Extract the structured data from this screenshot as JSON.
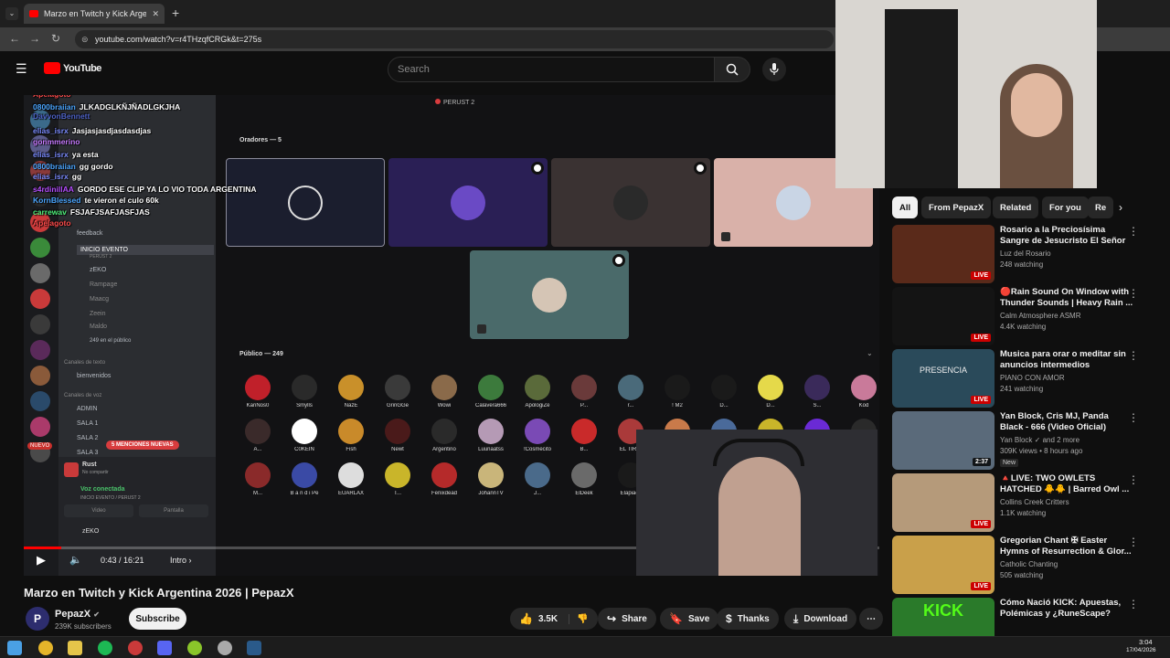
{
  "browser": {
    "tab_title": "Marzo en Twitch y Kick Argentina",
    "url": "youtube.com/watch?v=r4THzqfCRGk&t=275s"
  },
  "youtube": {
    "logo": "YouTube",
    "search_placeholder": "Search"
  },
  "overlay_chat": [
    {
      "user": "iilkhalifa7",
      "msg": "",
      "color": "#7b8cff"
    },
    {
      "user": "s4rdinillAA",
      "msg": "JAKJAJAKJAJKAJKJKAJAKAJKAJKA",
      "color": "#b64fff"
    },
    {
      "user": "elias_isrx",
      "msg": "",
      "color": "#7b8cff"
    },
    {
      "user": "Apelagoto",
      "msg": "",
      "color": "#ff4c4c"
    },
    {
      "user": "0800braiian",
      "msg": "JLKADGLKÑJÑADLGKJHA",
      "color": "#4ca6ff"
    },
    {
      "user": "DavvonBennett",
      "msg": "",
      "color": "#4f63c8"
    },
    {
      "user": "elias_isrx",
      "msg": "Jasjasjasdjasdasdjas",
      "color": "#7b8cff"
    },
    {
      "user": "gonmmerino",
      "msg": "",
      "color": "#c77bff"
    },
    {
      "user": "elias_isrx",
      "msg": "ya esta",
      "color": "#7b8cff"
    },
    {
      "user": "0800braiian",
      "msg": "gg gordo",
      "color": "#4ca6ff"
    },
    {
      "user": "elias_isrx",
      "msg": "gg",
      "color": "#7b8cff"
    },
    {
      "user": "s4rdinillAA",
      "msg": "GORDO ESE CLIP YA LO VIO TODA ARGENTINA",
      "color": "#b64fff"
    },
    {
      "user": "KornBlessed",
      "msg": "te vieron el culo 60k",
      "color": "#4ca6ff"
    },
    {
      "user": "carrewav",
      "msg": "FSJAFJSAFJASFJAS",
      "color": "#4ff07b"
    },
    {
      "user": "Apelagoto",
      "msg": "",
      "color": "#ff4c4c"
    }
  ],
  "discord": {
    "title": "PERUST 2",
    "speakers_label": "Oradores — 5",
    "audience_label": "Público — 249",
    "channels": [
      "feedback",
      "INICIO EVENTO",
      "PERUST 2",
      "zEKO",
      "Rampage",
      "zEKO",
      "Maacg",
      "Zeein",
      "Maldo",
      "249 en el público",
      "Canales de texto",
      "bienvenidos",
      "Canales de voz",
      "ADMIN",
      "SALA 1",
      "SALA 2",
      "SALA 3"
    ],
    "mentions_badge": "5 MENCIONES NUEVAS",
    "nuevo": "NUEVO",
    "new_badge": "NUEVO",
    "user_panel": {
      "name": "Rust",
      "sub": "No compartir",
      "voice": "Voz conectada",
      "voice_sub": "INICIO EVENTO / PERUST 2",
      "user": "zEKO"
    },
    "video_btn": "Video",
    "screen_btn": "Pantalla",
    "audience": [
      {
        "name": "KariÑos0",
        "color": "#c0202a"
      },
      {
        "name": "Smylls",
        "color": "#2a2a2a"
      },
      {
        "name": "NazE",
        "color": "#c9902a"
      },
      {
        "name": "GrinGGe",
        "color": "#3a3a3a"
      },
      {
        "name": "Wowi",
        "color": "#8a6a4a"
      },
      {
        "name": "Calavera666",
        "color": "#3c7a3c"
      },
      {
        "name": "ApologiZe",
        "color": "#5a6a3a"
      },
      {
        "name": "P...",
        "color": "#6a3a3a"
      },
      {
        "name": "r...",
        "color": "#4a6a7a"
      },
      {
        "name": "! M2",
        "color": "#1a1a1a"
      },
      {
        "name": "D...",
        "color": "#1a1a1a"
      },
      {
        "name": "D...",
        "color": "#e5d94a"
      },
      {
        "name": "S...",
        "color": "#3a2a5a"
      },
      {
        "name": "Kod",
        "color": "#c97a9a"
      },
      {
        "name": "A...",
        "color": "#3a2a2a"
      },
      {
        "name": "C0KEIN",
        "color": "#ffffff"
      },
      {
        "name": "Fish",
        "color": "#c98a2a"
      },
      {
        "name": "Newt",
        "color": "#4a1a1a"
      },
      {
        "name": "Argentino",
        "color": "#2a2a2a"
      },
      {
        "name": "Luunaatss",
        "color": "#b59ab5"
      },
      {
        "name": "!Cosmecito",
        "color": "#7a4ab5"
      },
      {
        "name": "B...",
        "color": "#c92a2a"
      },
      {
        "name": "EL TIRRI",
        "color": "#aa3a3a"
      },
      {
        "name": "Ay_Zarite",
        "color": "#c97a4a"
      },
      {
        "name": "L...",
        "color": "#4a6a9a"
      },
      {
        "name": "PUDÍN",
        "color": "#c9b52a"
      },
      {
        "name": "GaitoMC",
        "color": "#6a2ad5"
      },
      {
        "name": "S...",
        "color": "#2a2a2a"
      },
      {
        "name": "M...",
        "color": "#8a2a2a"
      },
      {
        "name": "B a n d i Pe",
        "color": "#3a4aa5"
      },
      {
        "name": "EUARLAX",
        "color": "#dddddd"
      },
      {
        "name": "T...",
        "color": "#c9b52a"
      },
      {
        "name": "Fenixdead",
        "color": "#b52a2a"
      },
      {
        "name": "JohannTV",
        "color": "#c9b57a"
      },
      {
        "name": "J...",
        "color": "#4a6a8a"
      },
      {
        "name": "ElDeek",
        "color": "#6a6a6a"
      },
      {
        "name": "Elapiack",
        "color": "#1a1a1a"
      },
      {
        "name": "Bikito",
        "color": "#3a2a3a"
      },
      {
        "name": "Bauty",
        "color": "#8a2a2a"
      },
      {
        "name": "N...",
        "color": "#c97a7a"
      },
      {
        "name": "Sonic4D",
        "color": "#3a5aa5"
      }
    ]
  },
  "controls": {
    "time": "0:43 / 16:21",
    "chapter": "Intro",
    "progress_fraction": 0.044
  },
  "video": {
    "title": "Marzo en Twitch y Kick Argentina 2026 | PepazX",
    "channel": "PepazX",
    "subscribers": "239K subscribers",
    "subscribe": "Subscribe",
    "likes": "3.5K",
    "share": "Share",
    "save": "Save",
    "thanks": "Thanks",
    "download": "Download"
  },
  "chips": [
    "All",
    "From PepazX",
    "Related",
    "For you",
    "Re"
  ],
  "related": [
    {
      "title": "Rosario a la Preciosísima Sangre de Jesucristo El Señor ...",
      "channel": "Luz del Rosario",
      "views": "248 watching",
      "badge": "LIVE",
      "thumb": "#5a2a1a"
    },
    {
      "title": "🔴Rain Sound On Window with Thunder Sounds | Heavy Rain ...",
      "channel": "Calm Atmosphere ASMR",
      "views": "4.4K watching",
      "badge": "LIVE",
      "thumb": "#141414"
    },
    {
      "title": "Musica para orar o meditar sin anuncios intermedios",
      "channel": "PIANO CON AMOR",
      "views": "241 watching",
      "badge": "LIVE",
      "thumb": "#2a4a5a",
      "thumb_text": "PRESENCIA"
    },
    {
      "title": "Yan Block, Cris MJ, Panda Black - 666 (Video Oficial)",
      "channel": "Yan Block ✓ and 2 more",
      "views": "309K views • 8 hours ago",
      "badge": "2:37",
      "new": "New",
      "thumb": "#5a6a7a"
    },
    {
      "title": "🔺LIVE: TWO OWLETS HATCHED 🐥🐥 | Barred Owl ...",
      "channel": "Collins Creek Critters",
      "views": "1.1K watching",
      "badge": "LIVE",
      "thumb": "#b59a7a"
    },
    {
      "title": "Gregorian Chant ✠ Easter Hymns of Resurrection & Glor...",
      "channel": "Catholic Chanting",
      "views": "505 watching",
      "badge": "LIVE",
      "thumb": "#c9a04a"
    },
    {
      "title": "Cómo Nació KICK: Apuestas, Polémicas y ¿RuneScape?",
      "channel": "SolidPTX",
      "views": "",
      "badge": "",
      "thumb": "#2a7a2a",
      "thumb_text": "KICK"
    }
  ],
  "taskbar": {
    "time": "3:04",
    "date": "17/04/2026"
  },
  "colors": {
    "accent": "#ff0000",
    "live": "#cc0000",
    "discord_bg": "#2b2d31"
  }
}
